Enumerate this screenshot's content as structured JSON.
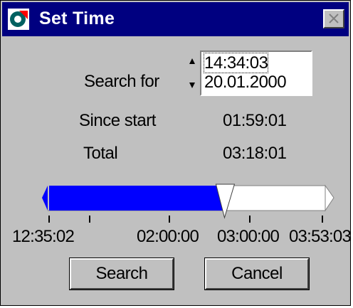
{
  "window": {
    "title": "Set Time",
    "close_icon": "close-icon"
  },
  "search_for": {
    "label": "Search for",
    "time_value": "14:34:03",
    "date_value": "20.01.2000"
  },
  "since_start": {
    "label": "Since start",
    "value": "01:59:01"
  },
  "total": {
    "label": "Total",
    "value": "03:18:01"
  },
  "timeline": {
    "start_label": "12:35:02",
    "tick_labels": [
      "02:00:00",
      "03:00:00",
      "03:53:03"
    ],
    "position_fraction": 0.63,
    "colors": {
      "elapsed": "#0000ff",
      "remaining": "#ffffff"
    }
  },
  "buttons": {
    "search": "Search",
    "cancel": "Cancel"
  },
  "colors": {
    "title_bar": "#000080",
    "face": "#c0c0c0"
  }
}
